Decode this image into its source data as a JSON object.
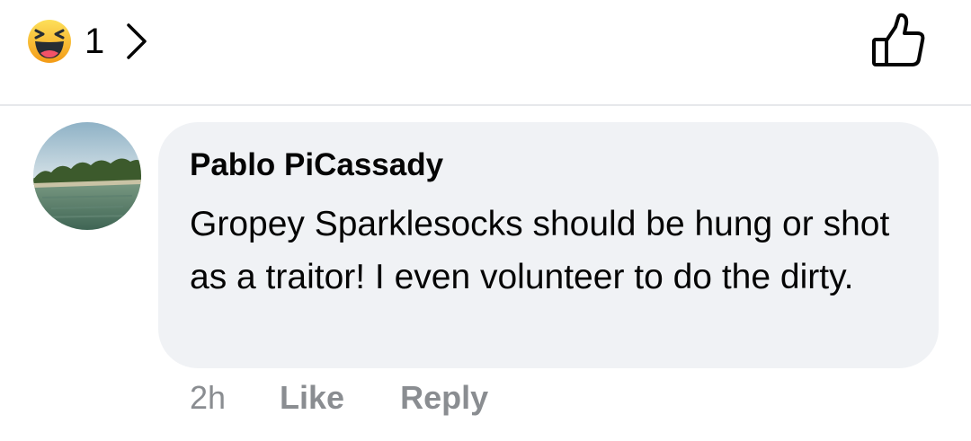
{
  "reactions": {
    "type_icon": "haha-emoji-icon",
    "count": "1"
  },
  "comment": {
    "author": "Pablo PiCassady",
    "text": "Gropey Sparklesocks should be hung or shot as a traitor! I even volunteer to do the dirty.",
    "timestamp": "2h",
    "like_label": "Like",
    "reply_label": "Reply"
  },
  "colors": {
    "bubble_background": "#f0f2f5",
    "secondary_text": "#8a8d91",
    "primary_text": "#050505",
    "haha_yellow": "#f7b125"
  },
  "icons": {
    "chevron": "chevron-right-icon",
    "like": "thumbs-up-outline-icon"
  }
}
